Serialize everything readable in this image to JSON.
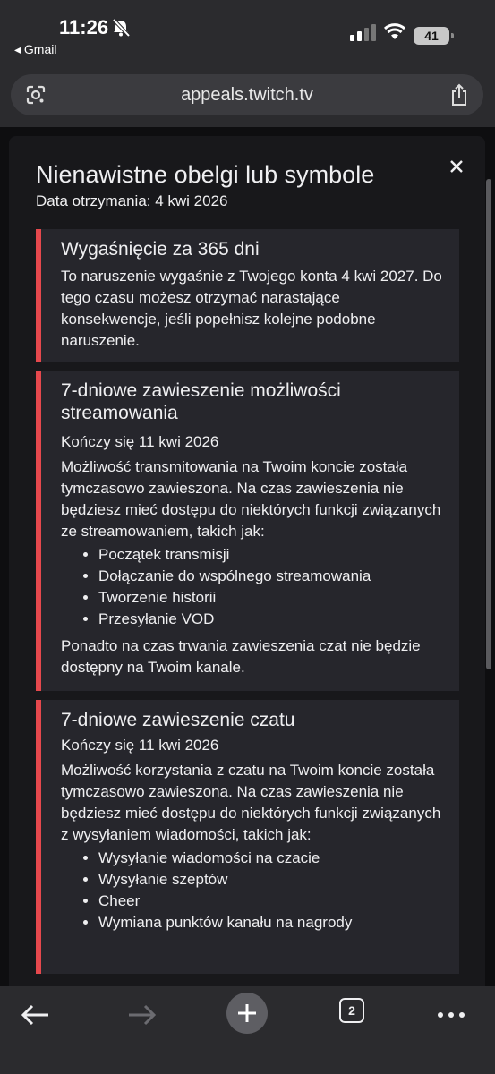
{
  "status_bar": {
    "time": "11:26",
    "back_app": "◂ Gmail",
    "battery": "41"
  },
  "browser": {
    "url": "appeals.twitch.tv",
    "tab_count": "2"
  },
  "modal": {
    "title": "Nienawistne obelgi lub symbole",
    "date": "Data otrzymania: 4 kwi 2026",
    "expiry": {
      "heading": "Wygaśnięcie za 365 dni",
      "text": "To naruszenie wygaśnie z Twojego konta 4 kwi 2027. Do tego czasu możesz otrzymać narastające konsekwencje, jeśli popełnisz kolejne podobne naruszenie."
    },
    "stream_suspension": {
      "heading": "7-dniowe zawieszenie możliwości streamowania",
      "ends": "Kończy się 11 kwi 2026",
      "text": "Możliwość transmitowania na Twoim koncie została tymczasowo zawieszona. Na czas zawieszenia nie będziesz mieć dostępu do niektórych funkcji związanych ze streamowaniem, takich jak:",
      "items": [
        "Początek transmisji",
        "Dołączanie do wspólnego streamowania",
        "Tworzenie historii",
        "Przesyłanie VOD"
      ],
      "footer": "Ponadto na czas trwania zawieszenia czat nie będzie dostępny na Twoim kanale."
    },
    "chat_suspension": {
      "heading": "7-dniowe zawieszenie czatu",
      "ends": "Kończy się 11 kwi 2026",
      "text": "Możliwość korzystania z czatu na Twoim koncie została tymczasowo zawieszona. Na czas zawieszenia nie będziesz mieć dostępu do niektórych funkcji związanych z wysyłaniem wiadomości, takich jak:",
      "items": [
        "Wysyłanie wiadomości na czacie",
        "Wysyłanie szeptów",
        "Cheer",
        "Wymiana punktów kanału na nagrody"
      ]
    }
  },
  "colors": {
    "accent": "#e5484d",
    "card_bg": "#26262c",
    "modal_bg": "#18181b"
  }
}
